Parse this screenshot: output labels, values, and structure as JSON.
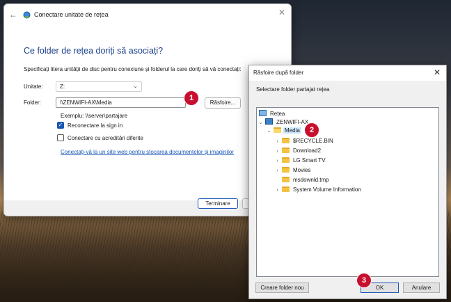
{
  "wizard": {
    "title": "Conectare unitate de rețea",
    "heading": "Ce folder de rețea doriți să asociați?",
    "description": "Specificați litera unității de disc pentru conexiune și folderul la care doriți să vă conectați:",
    "drive_label": "Unitate:",
    "drive_value": "Z:",
    "folder_label": "Folder:",
    "folder_value": "\\\\ZENWIFI-AX\\Media",
    "browse_label": "Răsfoire...",
    "example": "Exemplu: \\\\server\\partajare",
    "reconnect_label": "Reconectare la sign in",
    "reconnect_checked": true,
    "other_credentials_label": "Conectare cu acreditări diferite",
    "other_credentials_checked": false,
    "link_text": "Conectați-vă la un site web pentru stocarea documentelor și imaginilor",
    "finish_label": "Terminare"
  },
  "browse_dialog": {
    "title": "Răsfoire după folder",
    "description": "Selectare folder partajat rețea",
    "tree": [
      {
        "label": "Rețea",
        "icon": "network-icon",
        "expanded": true
      },
      {
        "label": "ZENWIFI-AX",
        "icon": "computer-icon",
        "expanded": true
      },
      {
        "label": "Media",
        "icon": "folder-open-icon",
        "expanded": true,
        "selected": true
      },
      {
        "label": "$RECYCLE.BIN",
        "icon": "folder-icon"
      },
      {
        "label": "Download2",
        "icon": "folder-icon"
      },
      {
        "label": "LG Smart TV",
        "icon": "folder-icon"
      },
      {
        "label": "Movies",
        "icon": "folder-icon"
      },
      {
        "label": "msdownld.tmp",
        "icon": "folder-icon"
      },
      {
        "label": "System Volume Information",
        "icon": "folder-icon"
      }
    ],
    "new_folder_label": "Creare folder nou",
    "ok_label": "OK",
    "cancel_label": "Anulare"
  },
  "callouts": [
    "1",
    "2",
    "3"
  ],
  "colors": {
    "accent": "#1a56b6",
    "heading": "#1a3f8a",
    "callout": "#c8102e",
    "selection": "#cde8ff"
  }
}
